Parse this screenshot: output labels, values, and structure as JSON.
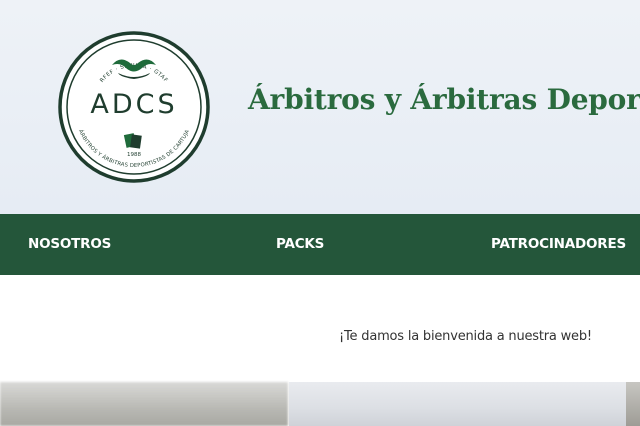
{
  "logo": {
    "top_text": "RFEF · SEVILLA · GTAF",
    "acronym": "ADCS",
    "bottom_text": "ÁRBITROS Y ÁRBITRAS DEPORTISTAS DE CARTUJA",
    "year": "1988",
    "colors": {
      "green": "#1f6b3b",
      "ring": "#1f3d2e"
    }
  },
  "header": {
    "title": "Árbitros y Árbitras Deporti"
  },
  "nav": {
    "items": [
      {
        "label": "NOSOTROS"
      },
      {
        "label": "PACKS"
      },
      {
        "label": "PATROCINADORES"
      }
    ],
    "background": "#24563a"
  },
  "main": {
    "welcome": "¡Te damos la bienvenida a nuestra web!"
  },
  "colors": {
    "title_green": "#2a6a3e",
    "header_bg": "#e6ecf4"
  }
}
